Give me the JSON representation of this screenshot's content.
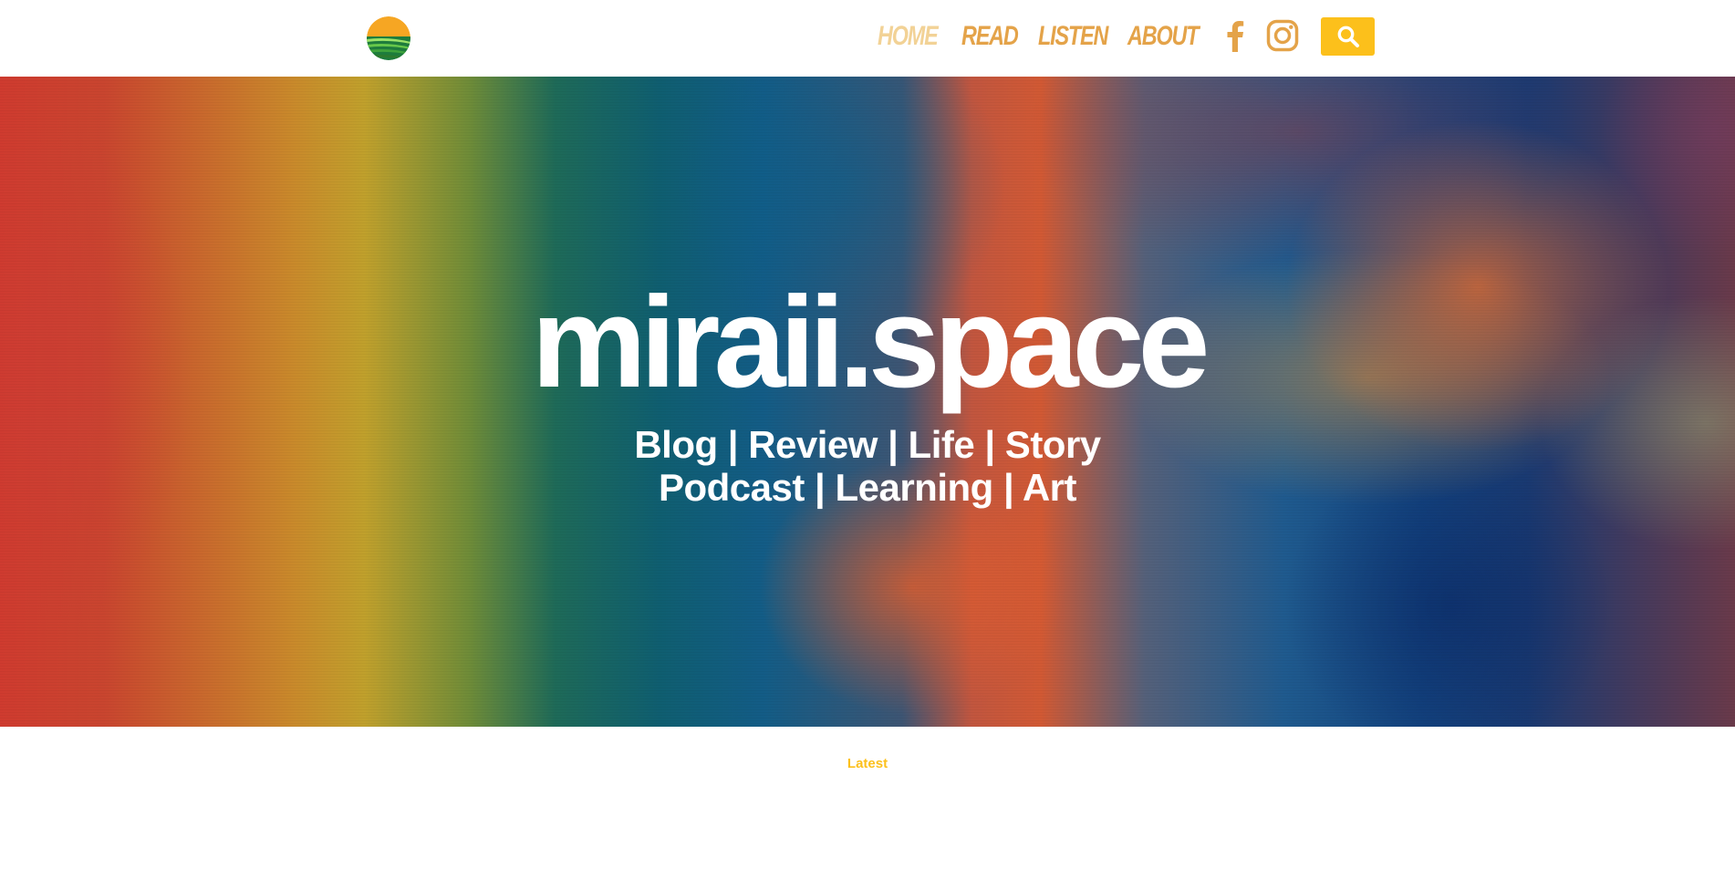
{
  "colors": {
    "accent": "#fcc01b",
    "nav_active": "#f2d296",
    "nav": "#e4a349",
    "hero_text": "#ffffff"
  },
  "header": {
    "logo_icon": "sunset-logo-icon",
    "nav": [
      {
        "label": "Home",
        "active": true
      },
      {
        "label": "Read",
        "active": false
      },
      {
        "label": "Listen",
        "active": false
      },
      {
        "label": "About",
        "active": false
      }
    ],
    "social": [
      {
        "icon": "facebook-icon"
      },
      {
        "icon": "instagram-icon"
      }
    ],
    "search_icon": "search-icon"
  },
  "hero": {
    "title": "miraii.space",
    "tagline_line1": "Blog | Review | Life | Story",
    "tagline_line2": "Podcast | Learning | Art"
  },
  "section": {
    "latest_label": "Latest"
  }
}
